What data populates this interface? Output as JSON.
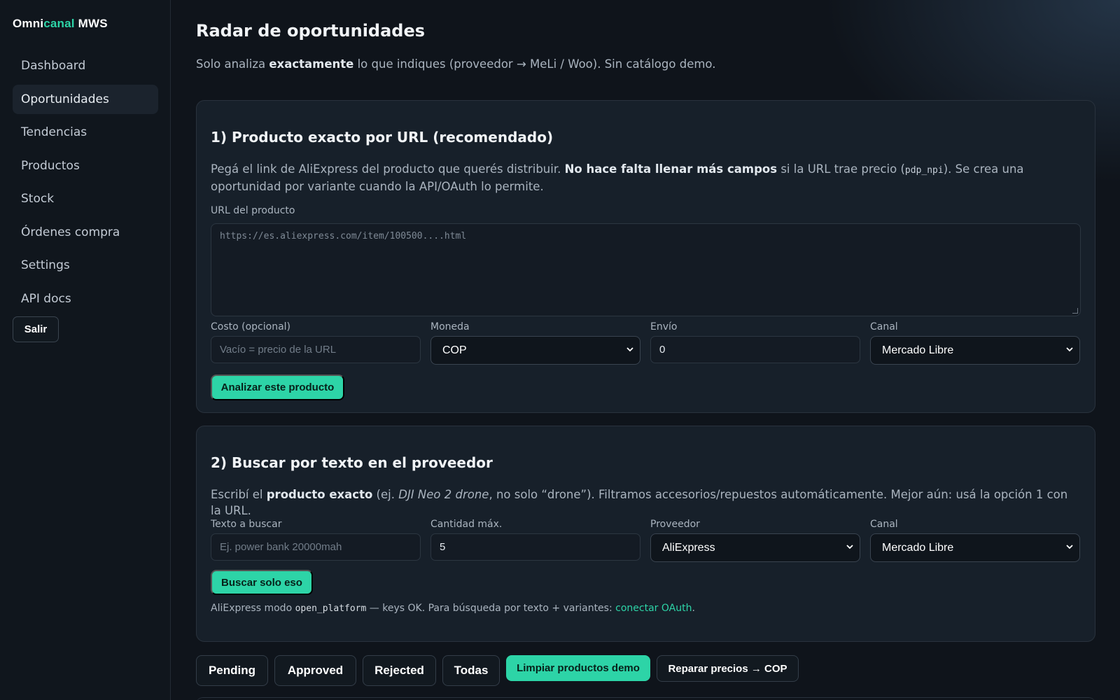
{
  "brand": {
    "part1": "Omni",
    "part2": "canal",
    "part3": " MWS"
  },
  "sidebar": {
    "items": [
      {
        "label": "Dashboard"
      },
      {
        "label": "Oportunidades"
      },
      {
        "label": "Tendencias"
      },
      {
        "label": "Productos"
      },
      {
        "label": "Stock"
      },
      {
        "label": "Órdenes compra"
      },
      {
        "label": "Settings"
      },
      {
        "label": "API docs"
      }
    ],
    "logout_label": "Salir"
  },
  "header": {
    "title": "Radar de oportunidades",
    "subtitle_pre": "Solo analiza ",
    "subtitle_bold": "exactamente",
    "subtitle_post": " lo que indiques (proveedor → MeLi / Woo). Sin catálogo demo."
  },
  "section1": {
    "title": "1) Producto exacto por URL (recomendado)",
    "desc_pre": "Pegá el link de AliExpress del producto que querés distribuir. ",
    "desc_bold": "No hace falta llenar más campos",
    "desc_mid": " si la URL trae precio (",
    "desc_code": "pdp_npi",
    "desc_post": "). Se crea una oportunidad por variante cuando la API/OAuth lo permite.",
    "url_label": "URL del producto",
    "url_placeholder": "https://es.aliexpress.com/item/100500....html",
    "cost_label": "Costo (opcional)",
    "cost_placeholder": "Vacío = precio de la URL",
    "currency_label": "Moneda",
    "currency_value": "COP",
    "shipping_label": "Envío",
    "shipping_value": "0",
    "channel_label": "Canal",
    "channel_value": "Mercado Libre",
    "submit_label": "Analizar este producto"
  },
  "section2": {
    "title": "2) Buscar por texto en el proveedor",
    "desc_pre": "Escribí el ",
    "desc_bold": "producto exacto",
    "desc_mid": " (ej. ",
    "desc_italic": "DJI Neo 2 drone",
    "desc_post": ", no solo “drone”). Filtramos accesorios/repuestos automáticamente. Mejor aún: usá la opción 1 con la URL.",
    "query_label": "Texto a buscar",
    "query_placeholder": "Ej. power bank 20000mah",
    "max_label": "Cantidad máx.",
    "max_value": "5",
    "provider_label": "Proveedor",
    "provider_value": "AliExpress",
    "channel_label": "Canal",
    "channel_value": "Mercado Libre",
    "submit_label": "Buscar solo eso",
    "note_pre": "AliExpress modo ",
    "note_code": "open_platform",
    "note_mid": " — keys OK. Para búsqueda por texto + variantes: ",
    "note_link": "conectar OAuth",
    "note_post": "."
  },
  "filters": {
    "pending": "Pending",
    "approved": "Approved",
    "rejected": "Rejected",
    "all": "Todas",
    "clear_demo": "Limpiar productos demo",
    "fix_prices": "Reparar precios → COP"
  }
}
